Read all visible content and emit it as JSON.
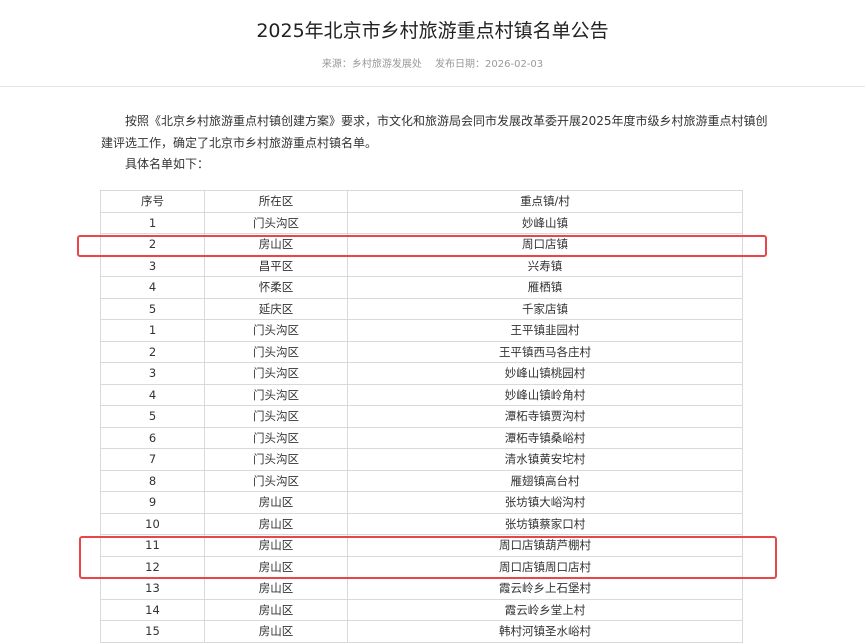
{
  "article": {
    "title": "2025年北京市乡村旅游重点村镇名单公告",
    "source": "来源：乡村旅游发展处",
    "date": "发布日期：2026-02-03",
    "paragraph1": "按照《北京乡村旅游重点村镇创建方案》要求，市文化和旅游局会同市发展改革委开展2025年度市级乡村旅游重点村镇创建评选工作，确定了北京市乡村旅游重点村镇名单。",
    "paragraph2": "具体名单如下："
  },
  "table": {
    "headers": [
      "序号",
      "所在区",
      "重点镇/村"
    ],
    "rows": [
      [
        "1",
        "门头沟区",
        "妙峰山镇"
      ],
      [
        "2",
        "房山区",
        "周口店镇"
      ],
      [
        "3",
        "昌平区",
        "兴寿镇"
      ],
      [
        "4",
        "怀柔区",
        "雁栖镇"
      ],
      [
        "5",
        "延庆区",
        "千家店镇"
      ],
      [
        "1",
        "门头沟区",
        "王平镇韭园村"
      ],
      [
        "2",
        "门头沟区",
        "王平镇西马各庄村"
      ],
      [
        "3",
        "门头沟区",
        "妙峰山镇桃园村"
      ],
      [
        "4",
        "门头沟区",
        "妙峰山镇岭角村"
      ],
      [
        "5",
        "门头沟区",
        "潭柘寺镇贾沟村"
      ],
      [
        "6",
        "门头沟区",
        "潭柘寺镇桑峪村"
      ],
      [
        "7",
        "门头沟区",
        "清水镇黄安坨村"
      ],
      [
        "8",
        "门头沟区",
        "雁翅镇高台村"
      ],
      [
        "9",
        "房山区",
        "张坊镇大峪沟村"
      ],
      [
        "10",
        "房山区",
        "张坊镇蔡家口村"
      ],
      [
        "11",
        "房山区",
        "周口店镇葫芦棚村"
      ],
      [
        "12",
        "房山区",
        "周口店镇周口店村"
      ],
      [
        "13",
        "房山区",
        "霞云岭乡上石堡村"
      ],
      [
        "14",
        "房山区",
        "霞云岭乡堂上村"
      ],
      [
        "15",
        "房山区",
        "韩村河镇圣水峪村"
      ]
    ]
  },
  "highlight_color": "#e8474a"
}
